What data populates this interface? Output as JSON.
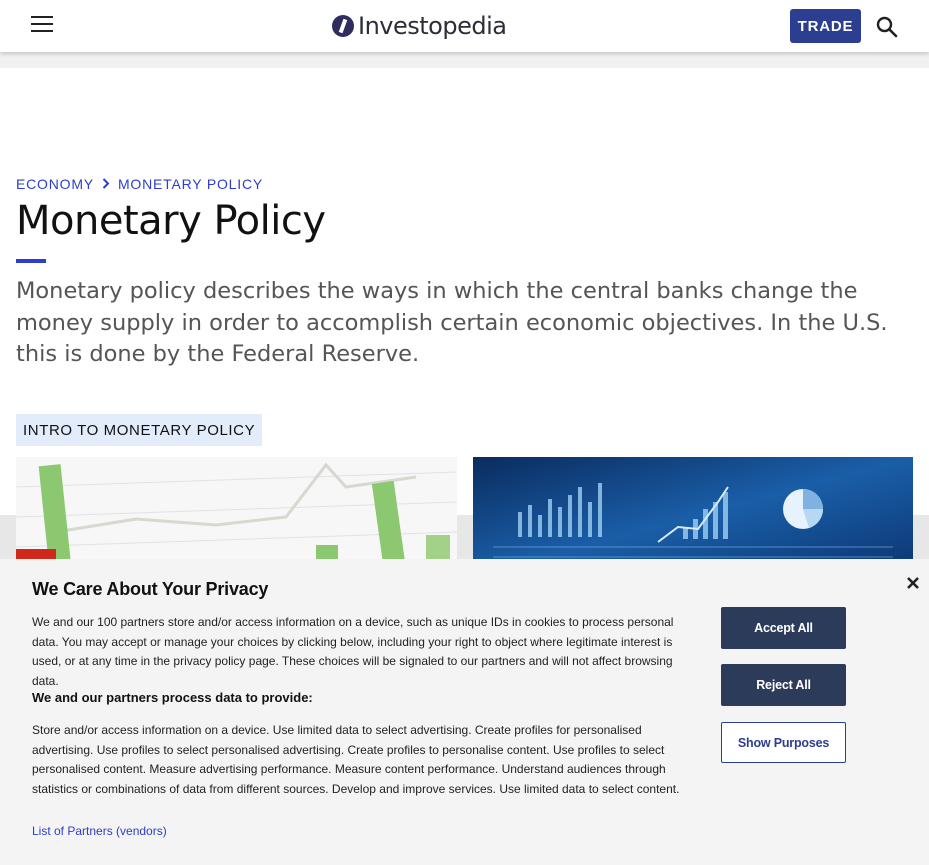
{
  "header": {
    "logo_text": "Investopedia",
    "trade_label": "TRADE"
  },
  "breadcrumb": {
    "items": [
      "ECONOMY",
      "MONETARY POLICY"
    ],
    "separator": "›"
  },
  "page": {
    "title": "Monetary Policy",
    "intro": "Monetary policy describes the ways in which the central banks change the money supply in order to accomplish certain economic objectives. In the U.S. this is done by the Federal Reserve.",
    "section_tag": "INTRO TO MONETARY POLICY"
  },
  "privacy": {
    "title": "We Care About Your Privacy",
    "paragraph1": "We and our 100 partners store and/or access information on a device, such as unique IDs in cookies to process personal data. You may accept or manage your choices by clicking below, including your right to object where legitimate interest is used, or at any time in the privacy policy page. These choices will be signaled to our partners and will not affect browsing data.",
    "subheading": "We and our partners process data to provide:",
    "paragraph2": "Store and/or access information on a device. Use limited data to select advertising. Create profiles for personalised advertising. Use profiles to select personalised advertising. Create profiles to personalise content. Use profiles to select personalised content. Measure advertising performance. Measure content performance. Understand audiences through statistics or combinations of data from different sources. Develop and improve services. Use limited data to select content.",
    "partners_link": "List of Partners (vendors)",
    "accept_label": "Accept All",
    "reject_label": "Reject All",
    "purposes_label": "Show Purposes"
  },
  "colors": {
    "brand_blue": "#2c3ecb",
    "trade_bg": "#2c3e8f",
    "button_dark": "#2d3b5a",
    "tag_bg": "#e3ecfb"
  },
  "icons": [
    "menu-icon",
    "logo-icon",
    "search-icon",
    "chevron-right-icon",
    "close-icon"
  ]
}
